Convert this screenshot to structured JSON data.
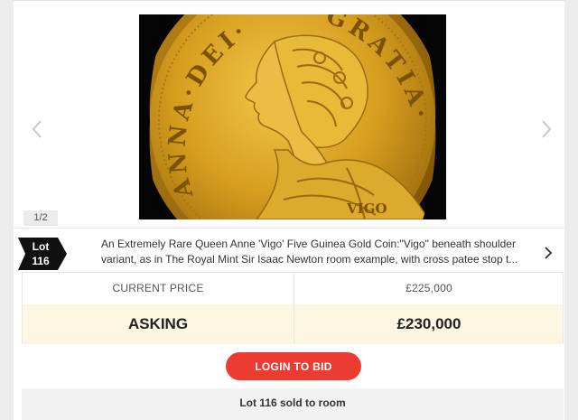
{
  "gallery": {
    "image_alt": "Queen Anne 'Vigo' Five Guinea gold coin, obverse",
    "coin_legend_left": "ANNA·DEI·",
    "coin_legend_right": "GRATIA·",
    "coin_mark": "VIGO",
    "counter": "1/2",
    "prev_icon": "chevron-left-icon",
    "next_icon": "chevron-right-icon"
  },
  "lot": {
    "label": "Lot",
    "number": "116",
    "description": "An Extremely Rare Queen Anne 'Vigo' Five Guinea Gold Coin:\"Vigo\" beneath shoulder variant, as in The Royal Mint Sir Isaac Newton room example, with cross patee stop t...",
    "tag_color": "#111111"
  },
  "price": {
    "current_label": "CURRENT PRICE",
    "current_value": "£225,000",
    "asking_label": "ASKING",
    "asking_value": "£230,000",
    "asking_bg": "#fcf6e3"
  },
  "actions": {
    "login_label": "LOGIN TO BID",
    "login_color": "#ee3b31"
  },
  "status": {
    "sold_text": "Lot 116 sold to room"
  }
}
